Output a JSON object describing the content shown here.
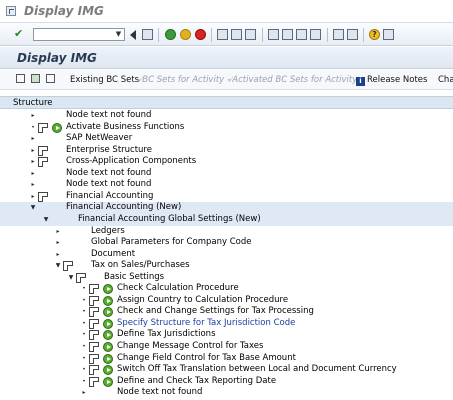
{
  "window": {
    "title": "Display IMG"
  },
  "screen": {
    "title": "Display IMG"
  },
  "app_toolbar": {
    "existing_bc_sets": "Existing BC Sets",
    "bc_sets_for_activity": "BC Sets for Activity",
    "activated_bc_sets": "Activated BC Sets for Activity",
    "release_notes": "Release Notes",
    "change_log": "Cha"
  },
  "tree": {
    "header": "Structure",
    "rows": [
      {
        "label": "Node text not found",
        "level": 0,
        "toggle": "collapsed",
        "icons": []
      },
      {
        "label": "Activate Business Functions",
        "level": 0,
        "toggle": "bullet",
        "icons": [
          "doc",
          "exe"
        ]
      },
      {
        "label": "SAP NetWeaver",
        "level": 0,
        "toggle": "collapsed",
        "icons": []
      },
      {
        "label": "Enterprise Structure",
        "level": 0,
        "toggle": "collapsed",
        "icons": [
          "doc"
        ]
      },
      {
        "label": "Cross-Application Components",
        "level": 0,
        "toggle": "collapsed",
        "icons": [
          "doc"
        ]
      },
      {
        "label": "Node text not found",
        "level": 0,
        "toggle": "collapsed",
        "icons": []
      },
      {
        "label": "Node text not found",
        "level": 0,
        "toggle": "collapsed",
        "icons": []
      },
      {
        "label": "Financial Accounting",
        "level": 0,
        "toggle": "collapsed",
        "icons": [
          "doc"
        ]
      },
      {
        "label": "Financial Accounting (New)",
        "level": 0,
        "toggle": "expanded",
        "icons": [],
        "highlight": true
      },
      {
        "label": "Financial Accounting Global Settings (New)",
        "level": 1,
        "toggle": "expanded",
        "icons": [],
        "highlight": true
      },
      {
        "label": "Ledgers",
        "level": 2,
        "toggle": "collapsed",
        "icons": []
      },
      {
        "label": "Global Parameters for Company Code",
        "level": 2,
        "toggle": "collapsed",
        "icons": []
      },
      {
        "label": "Document",
        "level": 2,
        "toggle": "collapsed",
        "icons": []
      },
      {
        "label": "Tax on Sales/Purchases",
        "level": 2,
        "toggle": "expanded",
        "icons": [
          "doc"
        ]
      },
      {
        "label": "Basic Settings",
        "level": 3,
        "toggle": "expanded",
        "icons": [
          "doc"
        ]
      },
      {
        "label": "Check Calculation Procedure",
        "level": 4,
        "toggle": "bullet",
        "icons": [
          "doc",
          "exe"
        ]
      },
      {
        "label": "Assign Country to Calculation Procedure",
        "level": 4,
        "toggle": "bullet",
        "icons": [
          "doc",
          "exe"
        ]
      },
      {
        "label": "Check and Change Settings for Tax Processing",
        "level": 4,
        "toggle": "bullet",
        "icons": [
          "doc",
          "exe"
        ]
      },
      {
        "label": "Specify Structure for Tax Jurisdiction Code",
        "level": 4,
        "toggle": "bullet",
        "icons": [
          "doc",
          "exe"
        ],
        "link": true
      },
      {
        "label": "Define Tax Jurisdictions",
        "level": 4,
        "toggle": "bullet",
        "icons": [
          "doc",
          "exe"
        ]
      },
      {
        "label": "Change Message Control for Taxes",
        "level": 4,
        "toggle": "bullet",
        "icons": [
          "doc",
          "exe"
        ]
      },
      {
        "label": "Change Field Control for Tax Base Amount",
        "level": 4,
        "toggle": "bullet",
        "icons": [
          "doc",
          "exe"
        ]
      },
      {
        "label": "Switch Off Tax Translation between Local and Document Currency",
        "level": 4,
        "toggle": "bullet",
        "icons": [
          "doc",
          "exe"
        ]
      },
      {
        "label": "Define and Check Tax Reporting Date",
        "level": 4,
        "toggle": "bullet",
        "icons": [
          "doc",
          "exe"
        ]
      },
      {
        "label": "Node text not found",
        "level": 4,
        "toggle": "collapsed",
        "icons": []
      }
    ]
  },
  "colors": {
    "link": "#1a3f9e",
    "highlight_row": "#dfe9f5",
    "header_bar": "#dbe6f3"
  }
}
